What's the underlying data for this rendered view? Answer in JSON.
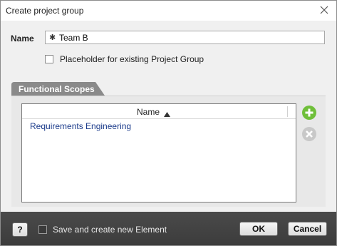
{
  "dialog": {
    "title": "Create project group"
  },
  "form": {
    "name_label": "Name",
    "name_value": "Team B",
    "required_mark": "✱",
    "placeholder_checkbox_label": "Placeholder for existing Project Group",
    "placeholder_checked": false
  },
  "scopes": {
    "tab_label": "Functional Scopes",
    "column_header": "Name",
    "sort": "ascending",
    "rows": [
      "Requirements Engineering"
    ]
  },
  "footer": {
    "help_label": "?",
    "save_new_label": "Save and create new Element",
    "save_new_checked": false,
    "ok_label": "OK",
    "cancel_label": "Cancel"
  },
  "colors": {
    "add_button": "#6fbf3a",
    "remove_button": "#c8c8c8",
    "tab_background": "#8a8a8a",
    "link_text": "#1a3a8a"
  }
}
